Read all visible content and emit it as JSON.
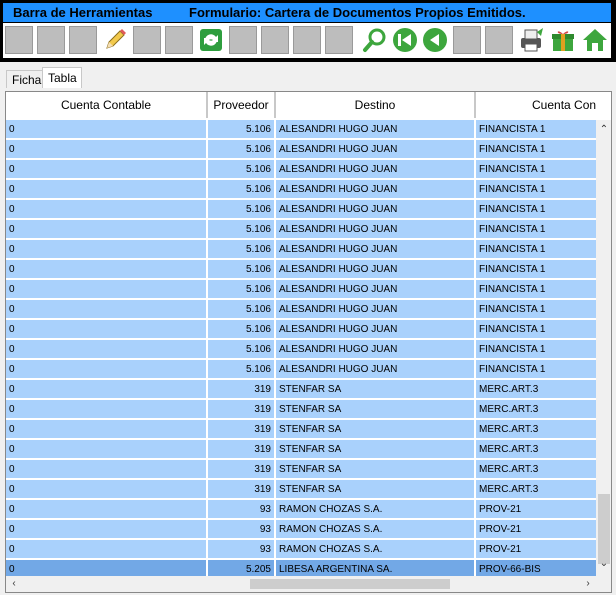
{
  "toolbar": {
    "title_left": "Barra de Herramientas",
    "title_right": "Formulario: Cartera de Documentos Propios Emitidos.",
    "accent_color": "#1e90ff",
    "buttons": [
      {
        "name": "new-record-icon",
        "enabled": false
      },
      {
        "name": "save-icon",
        "enabled": false
      },
      {
        "name": "save-as-icon",
        "enabled": false
      },
      {
        "name": "edit-pencil-icon",
        "enabled": true
      },
      {
        "name": "delete-icon",
        "enabled": false
      },
      {
        "name": "undo-icon",
        "enabled": false
      },
      {
        "name": "refresh-icon",
        "enabled": true
      },
      {
        "name": "film-icon",
        "enabled": false
      },
      {
        "name": "list-icon",
        "enabled": false
      },
      {
        "name": "grid-icon",
        "enabled": false
      },
      {
        "name": "columns-icon",
        "enabled": false
      },
      {
        "name": "search-icon",
        "enabled": true
      },
      {
        "name": "first-record-icon",
        "enabled": true
      },
      {
        "name": "previous-record-icon",
        "enabled": true
      },
      {
        "name": "next-record-icon",
        "enabled": false
      },
      {
        "name": "last-record-icon",
        "enabled": false
      },
      {
        "name": "print-icon",
        "enabled": true
      },
      {
        "name": "gift-icon",
        "enabled": true
      },
      {
        "name": "home-icon",
        "enabled": true
      }
    ]
  },
  "tabs": [
    {
      "label": "Ficha",
      "active": false
    },
    {
      "label": "Tabla",
      "active": true
    }
  ],
  "grid": {
    "columns": [
      "Cuenta Contable",
      "Proveedor",
      "Destino",
      "Cuenta Con"
    ],
    "rows": [
      [
        "0",
        "5.106",
        "ALESANDRI HUGO JUAN",
        "FINANCISTA 1"
      ],
      [
        "0",
        "5.106",
        "ALESANDRI HUGO JUAN",
        "FINANCISTA 1"
      ],
      [
        "0",
        "5.106",
        "ALESANDRI HUGO JUAN",
        "FINANCISTA 1"
      ],
      [
        "0",
        "5.106",
        "ALESANDRI HUGO JUAN",
        "FINANCISTA 1"
      ],
      [
        "0",
        "5.106",
        "ALESANDRI HUGO JUAN",
        "FINANCISTA 1"
      ],
      [
        "0",
        "5.106",
        "ALESANDRI HUGO JUAN",
        "FINANCISTA 1"
      ],
      [
        "0",
        "5.106",
        "ALESANDRI HUGO JUAN",
        "FINANCISTA 1"
      ],
      [
        "0",
        "5.106",
        "ALESANDRI HUGO JUAN",
        "FINANCISTA 1"
      ],
      [
        "0",
        "5.106",
        "ALESANDRI HUGO JUAN",
        "FINANCISTA 1"
      ],
      [
        "0",
        "5.106",
        "ALESANDRI HUGO JUAN",
        "FINANCISTA 1"
      ],
      [
        "0",
        "5.106",
        "ALESANDRI HUGO JUAN",
        "FINANCISTA 1"
      ],
      [
        "0",
        "5.106",
        "ALESANDRI HUGO JUAN",
        "FINANCISTA 1"
      ],
      [
        "0",
        "5.106",
        "ALESANDRI HUGO JUAN",
        "FINANCISTA 1"
      ],
      [
        "0",
        "319",
        "STENFAR SA",
        "MERC.ART.3"
      ],
      [
        "0",
        "319",
        "STENFAR SA",
        "MERC.ART.3"
      ],
      [
        "0",
        "319",
        "STENFAR SA",
        "MERC.ART.3"
      ],
      [
        "0",
        "319",
        "STENFAR SA",
        "MERC.ART.3"
      ],
      [
        "0",
        "319",
        "STENFAR SA",
        "MERC.ART.3"
      ],
      [
        "0",
        "319",
        "STENFAR SA",
        "MERC.ART.3"
      ],
      [
        "0",
        "93",
        "RAMON CHOZAS S.A.",
        "PROV-21"
      ],
      [
        "0",
        "93",
        "RAMON CHOZAS S.A.",
        "PROV-21"
      ],
      [
        "0",
        "93",
        "RAMON CHOZAS S.A.",
        "PROV-21"
      ],
      [
        "0",
        "5.205",
        "LIBESA ARGENTINA SA.",
        "PROV-66-BIS"
      ]
    ],
    "selected_row": 22,
    "row_color": "#a9d1fc",
    "selected_color": "#72a8e6"
  }
}
